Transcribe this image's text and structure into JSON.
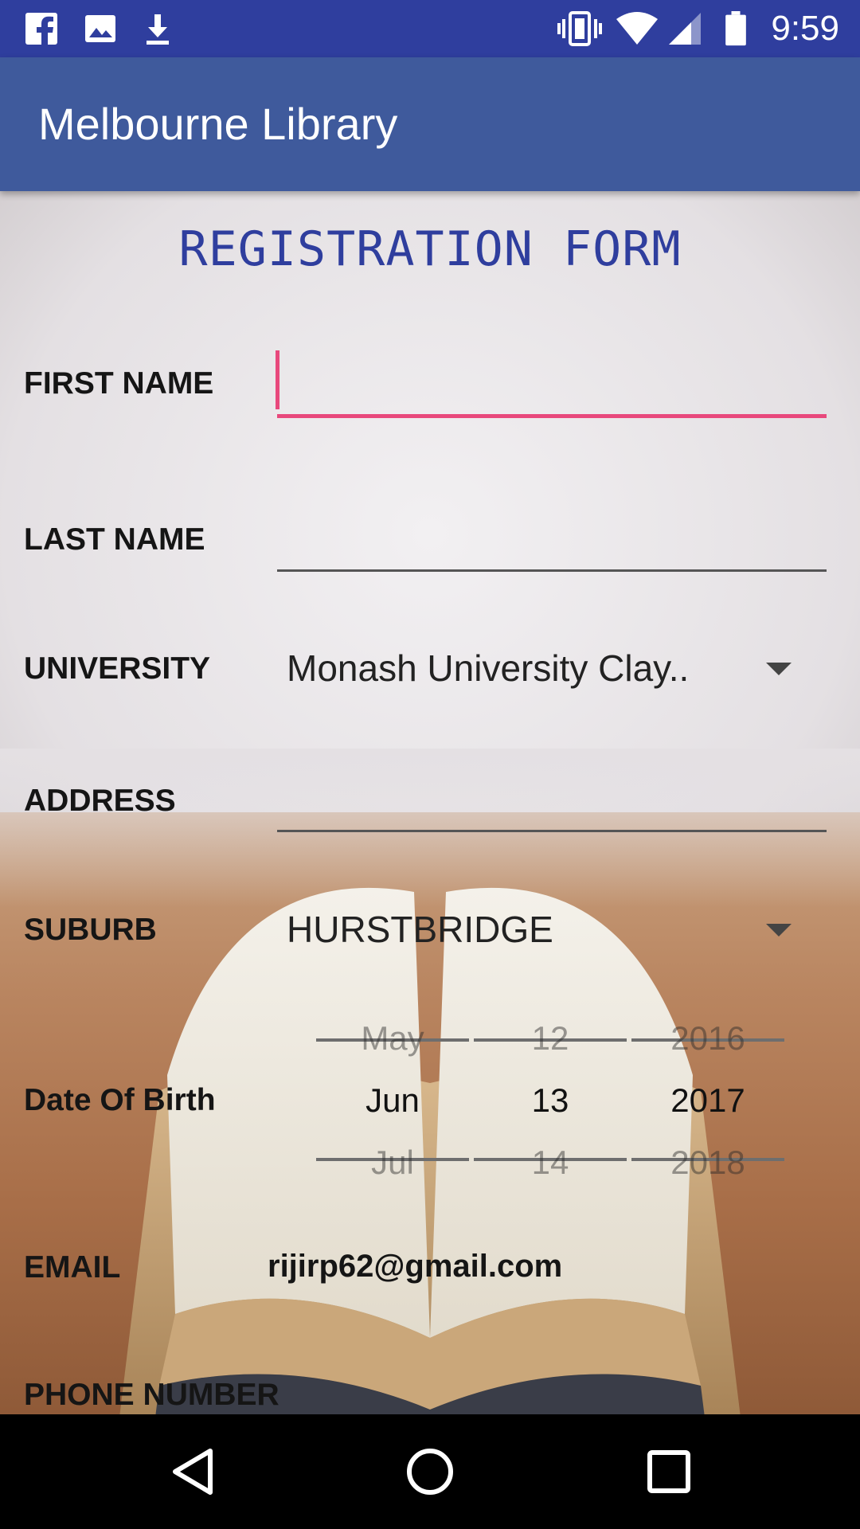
{
  "status_bar": {
    "time": "9:59",
    "left_icons": [
      "facebook-icon",
      "image-icon",
      "download-icon"
    ],
    "right_icons": [
      "vibrate-icon",
      "wifi-icon",
      "signal-icon",
      "battery-icon"
    ]
  },
  "app_bar": {
    "title": "Melbourne Library",
    "color": "#3f5a9c"
  },
  "form": {
    "title": "REGISTRATION FORM",
    "first_name": {
      "label": "FIRST NAME",
      "value": ""
    },
    "last_name": {
      "label": "LAST NAME",
      "value": ""
    },
    "university": {
      "label": "UNIVERSITY",
      "selected": "Monash University Clay.."
    },
    "address": {
      "label": "ADDRESS",
      "value": ""
    },
    "suburb": {
      "label": "SUBURB",
      "selected": "HURSTBRIDGE"
    },
    "dob": {
      "label": "Date Of Birth",
      "months": [
        "May",
        "Jun",
        "Jul"
      ],
      "days": [
        "12",
        "13",
        "14"
      ],
      "years": [
        "2016",
        "2017",
        "2018"
      ]
    },
    "email": {
      "label": "EMAIL",
      "value": "rijirp62@gmail.com"
    },
    "phone": {
      "label": "PHONE NUMBER"
    }
  },
  "nav_bar": {
    "buttons": [
      "back-icon",
      "home-icon",
      "recents-icon"
    ]
  },
  "colors": {
    "status_bar": "#2f3e9e",
    "accent": "#e8487c",
    "title": "#2f3e9e"
  }
}
